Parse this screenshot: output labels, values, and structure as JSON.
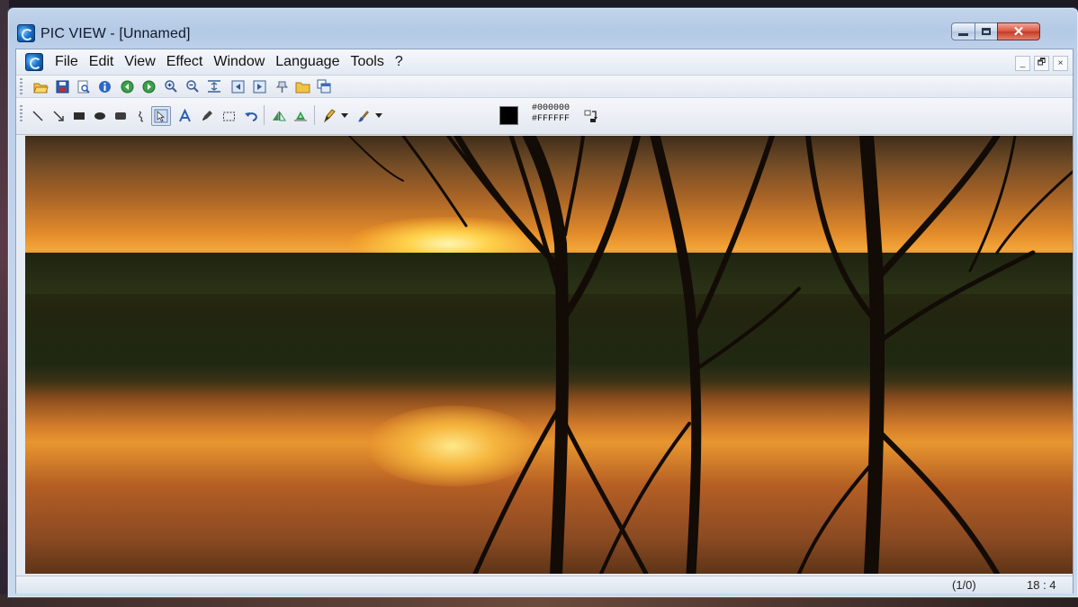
{
  "window": {
    "title": "PIC VIEW  - [Unnamed]"
  },
  "menubar": {
    "items": [
      "File",
      "Edit",
      "View",
      "Effect",
      "Window",
      "Language",
      "Tools",
      "?"
    ]
  },
  "mdi_controls": {
    "minimize": "_",
    "restore": "🗗",
    "close": "×"
  },
  "toolbar_main": {
    "icons": [
      "open-folder-icon",
      "save-icon",
      "print-preview-icon",
      "info-icon",
      "previous-icon",
      "next-icon",
      "zoom-in-icon",
      "zoom-out-icon",
      "fit-icon",
      "first-page-icon",
      "last-page-icon",
      "pin-icon",
      "folder-icon",
      "copy-window-icon"
    ]
  },
  "toolbar_draw": {
    "icons": [
      "line-icon",
      "arrow-line-icon",
      "filled-rectangle-icon",
      "ellipse-icon",
      "rounded-rectangle-icon",
      "freehand-icon",
      "select-object-icon",
      "text-icon",
      "pen-icon",
      "selection-rectangle-icon",
      "undo-icon",
      "flip-left-icon",
      "flip-right-icon",
      "pencil-icon",
      "brush-icon"
    ],
    "foreground_hex": "#000000",
    "background_hex": "#FFFFFF",
    "swatch_color": "#000000"
  },
  "status": {
    "page": "(1/0)",
    "ratio": "18 : 4"
  }
}
